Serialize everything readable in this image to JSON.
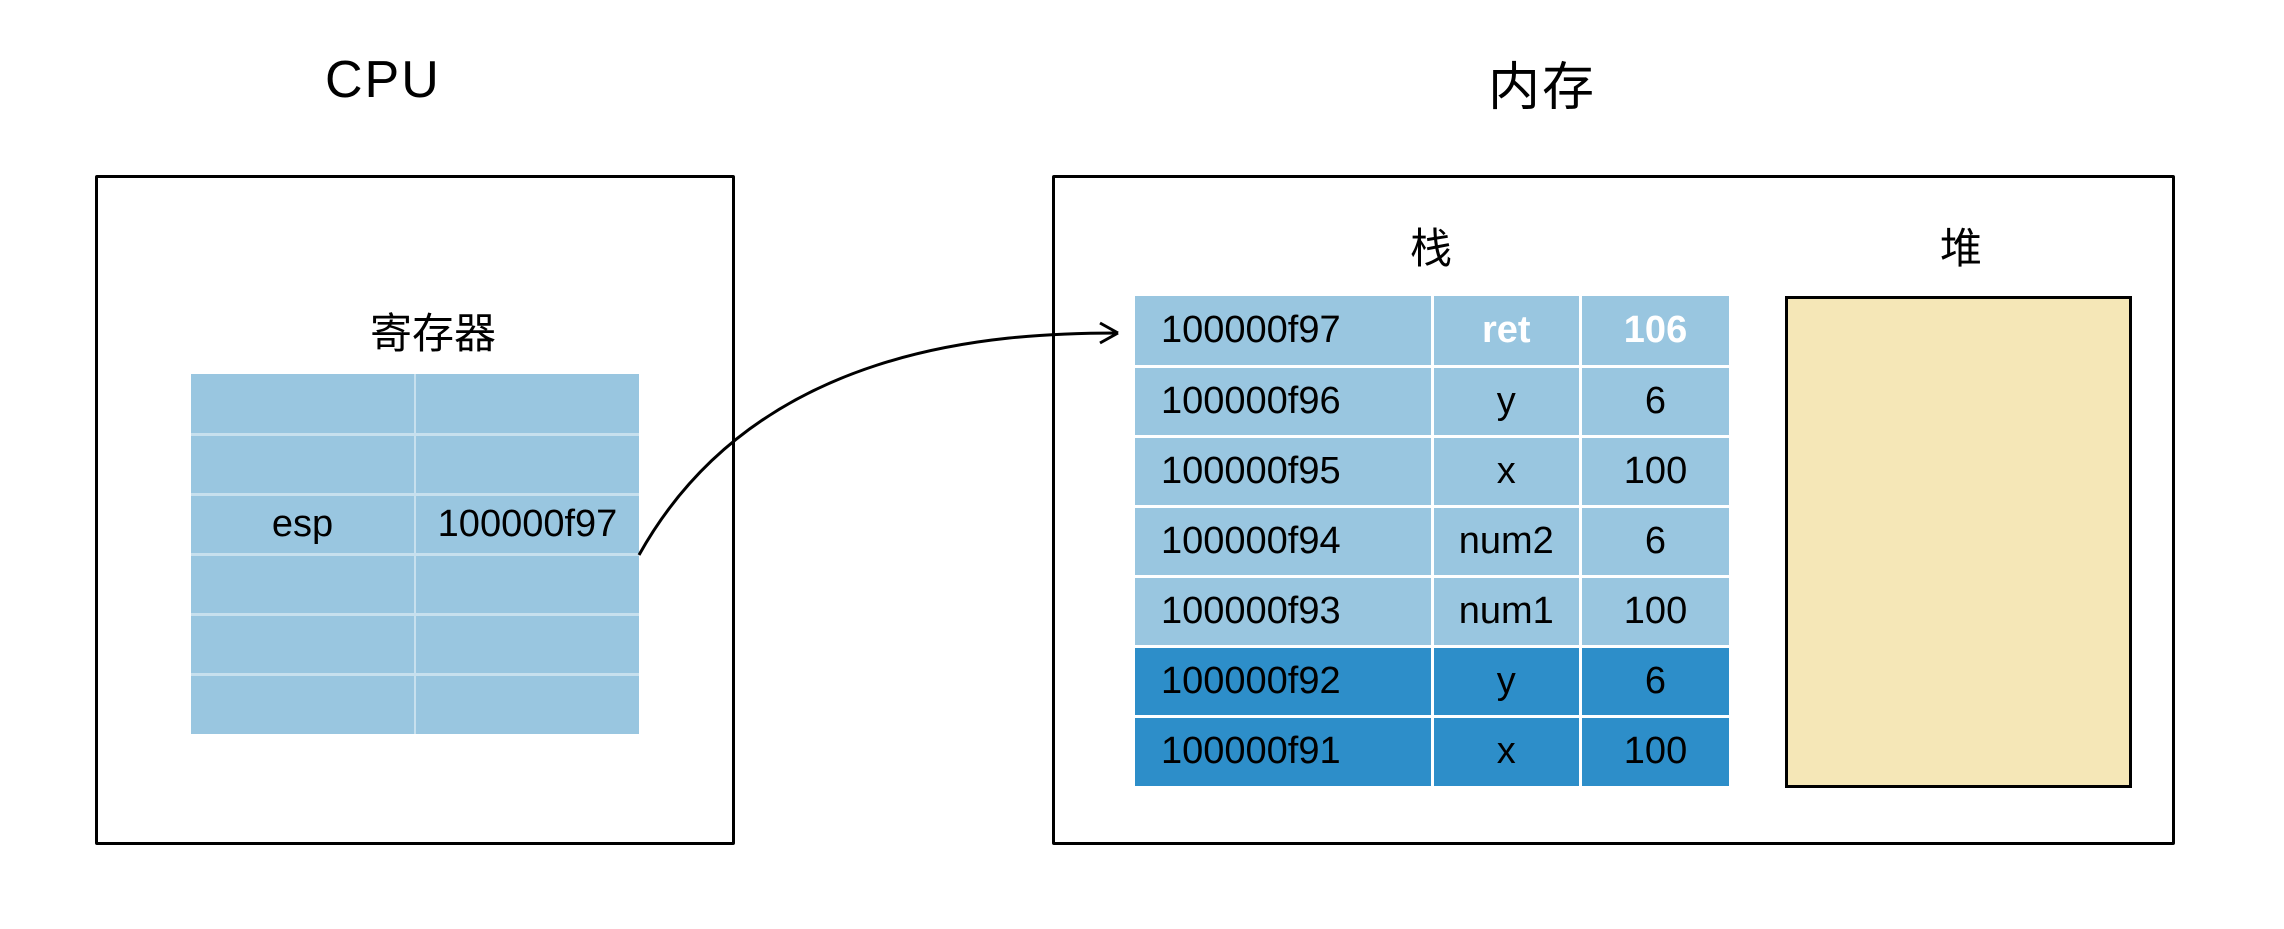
{
  "cpu": {
    "title": "CPU",
    "registers_label": "寄存器",
    "esp_row": {
      "name": "esp",
      "value": "100000f97"
    }
  },
  "memory": {
    "title": "内存",
    "stack_label": "栈",
    "heap_label": "堆",
    "stack": [
      {
        "addr": "100000f97",
        "name": "ret",
        "value": "106",
        "highlight": true
      },
      {
        "addr": "100000f96",
        "name": "y",
        "value": "6"
      },
      {
        "addr": "100000f95",
        "name": "x",
        "value": "100"
      },
      {
        "addr": "100000f94",
        "name": "num2",
        "value": "6"
      },
      {
        "addr": "100000f93",
        "name": "num1",
        "value": "100"
      },
      {
        "addr": "100000f92",
        "name": "y",
        "value": "6",
        "dark": true
      },
      {
        "addr": "100000f91",
        "name": "x",
        "value": "100",
        "dark": true
      }
    ]
  }
}
